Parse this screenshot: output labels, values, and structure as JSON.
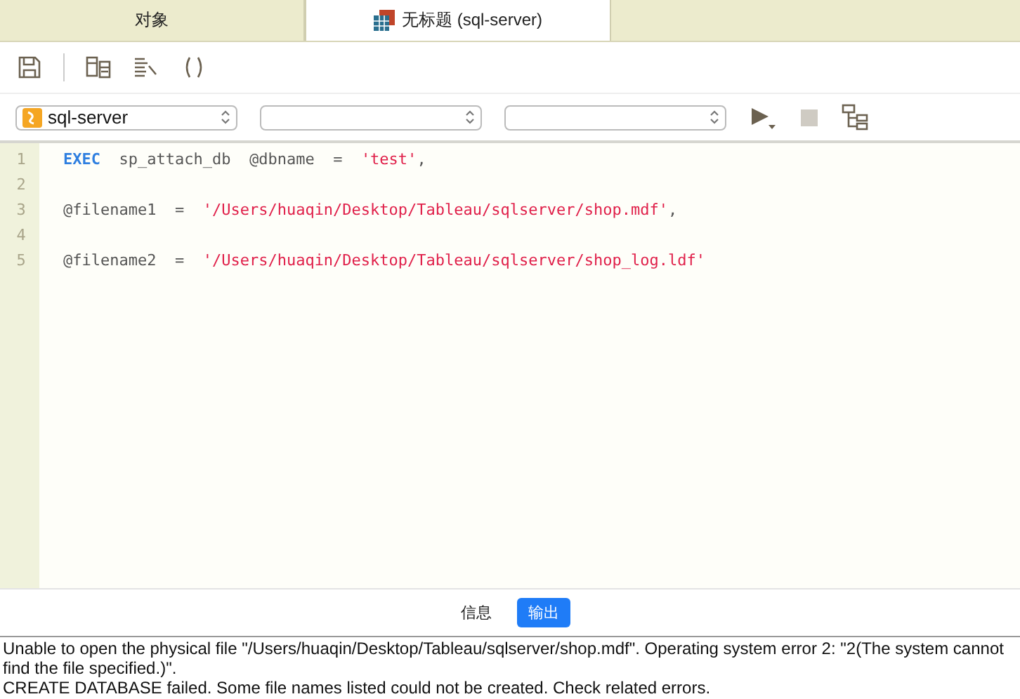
{
  "tabs": [
    {
      "label": "对象",
      "selected": false,
      "kind": "objects"
    },
    {
      "label": "无标题 (sql-server)",
      "selected": true,
      "kind": "query"
    }
  ],
  "connection": {
    "value": "sql-server"
  },
  "selectors": [
    {
      "kind": "dropdown"
    },
    {
      "kind": "dropdown"
    }
  ],
  "stop_disabled": true,
  "code_lines": [
    {
      "number": "1",
      "tokens": [
        {
          "kind": "keyword",
          "text": "EXEC"
        },
        {
          "kind": "plain",
          "text": "  sp_attach_db  @dbname  =  "
        },
        {
          "kind": "string",
          "text": "'test'"
        },
        {
          "kind": "plain",
          "text": ","
        }
      ]
    },
    {
      "number": "2"
    },
    {
      "number": "3",
      "tokens": [
        {
          "kind": "plain",
          "text": "@filename1  =  "
        },
        {
          "kind": "string",
          "text": "'/Users/huaqin/Desktop/Tableau/sqlserver/shop.mdf'"
        },
        {
          "kind": "plain",
          "text": ","
        }
      ]
    },
    {
      "number": "4"
    },
    {
      "number": "5",
      "tokens": [
        {
          "kind": "plain",
          "text": "@filename2  =  "
        },
        {
          "kind": "string",
          "text": "'/Users/huaqin/Desktop/Tableau/sqlserver/shop_log.ldf'"
        }
      ]
    }
  ],
  "result_tabs": [
    {
      "label": "信息",
      "selected": false
    },
    {
      "label": "输出",
      "selected": true
    }
  ],
  "messages": [
    "Unable to open the physical file \"/Users/huaqin/Desktop/Tableau/sqlserver/shop.mdf\". Operating system error 2: \"2(The system cannot find the file specified.)\".",
    "CREATE DATABASE failed. Some file names listed could not be created. Check related errors."
  ]
}
